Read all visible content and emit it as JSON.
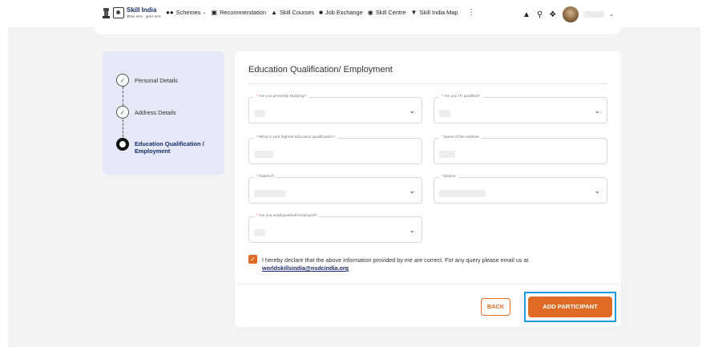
{
  "header": {
    "logo_text": "Skill India",
    "logo_subtext": "कौशल भारत - कुशल भारत",
    "nav": [
      {
        "label": "Schemes",
        "icon": "schemes-icon",
        "has_dropdown": true
      },
      {
        "label": "Recommendation",
        "icon": "recommendation-icon",
        "has_dropdown": false
      },
      {
        "label": "Skill Courses",
        "icon": "graduation-cap-icon",
        "has_dropdown": false
      },
      {
        "label": "Job Exchange",
        "icon": "briefcase-icon",
        "has_dropdown": false
      },
      {
        "label": "Skill Centre",
        "icon": "location-pin-icon",
        "has_dropdown": false
      },
      {
        "label": "Skill India Map",
        "icon": "india-map-icon",
        "has_dropdown": false
      }
    ],
    "icons": [
      "kebab-menu-icon",
      "bell-icon",
      "search-icon",
      "help-icon",
      "chevron-down-icon"
    ]
  },
  "stepper": {
    "steps": [
      {
        "label": "Personal Details",
        "status": "completed"
      },
      {
        "label": "Address Details",
        "status": "completed"
      },
      {
        "label": "Education Qualification / Employment",
        "status": "active"
      }
    ]
  },
  "form": {
    "title": "Education Qualification/ Employment",
    "fields": [
      {
        "label": "Are you presently studying?",
        "type": "select",
        "required": true
      },
      {
        "label": "Are you ITI qualified?",
        "type": "select",
        "required": true
      },
      {
        "label": "What is your highest education qualification?",
        "type": "text",
        "required": true
      },
      {
        "label": "Name of the institute",
        "type": "text",
        "required": true
      },
      {
        "label": "State/UT",
        "type": "select",
        "required": true
      },
      {
        "label": "District",
        "type": "select",
        "required": true
      },
      {
        "label": "Are you employed/self-employed?",
        "type": "select",
        "required": true
      }
    ],
    "declaration": {
      "checked": true,
      "text": "I hereby declare that the above information provided by me are correct. For any query please email us at",
      "email": "worldskillsindia@nsdcindia.org"
    }
  },
  "actions": {
    "back_label": "BACK",
    "add_label": "ADD PARTICIPANT"
  },
  "colors": {
    "accent": "#e06b25",
    "stepper_bg": "#e4e8f7",
    "focus_outline": "#1b9be0",
    "page_bg": "#f3f3f5"
  }
}
